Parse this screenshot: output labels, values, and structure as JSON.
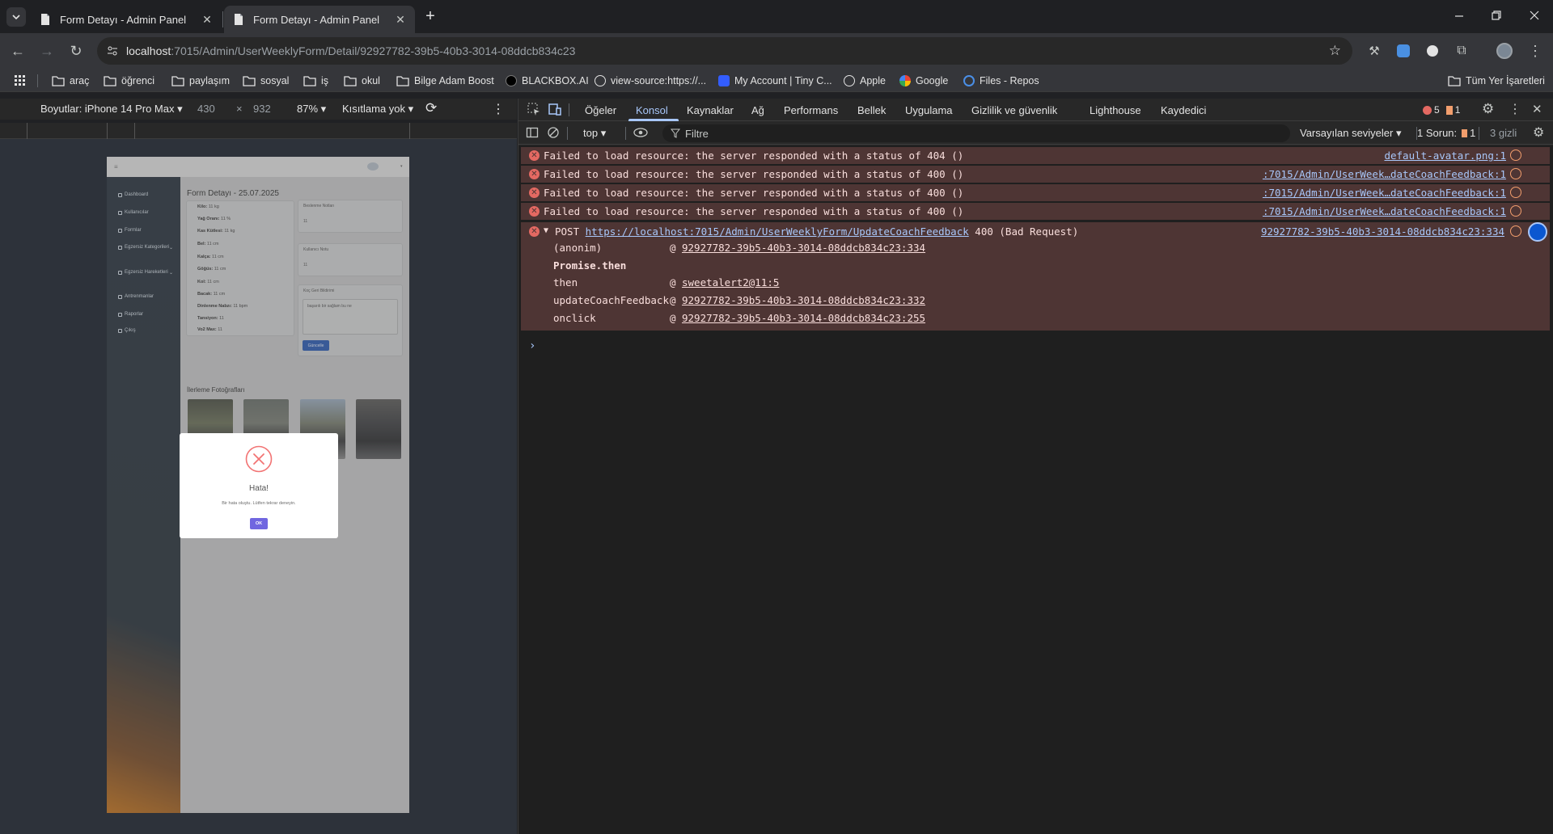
{
  "browser": {
    "tabs": [
      {
        "title": "Form Detayı - Admin Panel",
        "active": false
      },
      {
        "title": "Form Detayı - Admin Panel",
        "active": true
      }
    ],
    "url_host": "localhost",
    "url_rest": ":7015/Admin/UserWeeklyForm/Detail/92927782-39b5-40b3-3014-08ddcb834c23",
    "bookmarks": [
      "araç",
      "öğrenci",
      "paylaşım",
      "sosyal",
      "iş",
      "okul",
      "Bilge Adam Boost",
      "BLACKBOX.AI",
      "view-source:https://...",
      "My Account | Tiny C...",
      "Apple",
      "Google",
      "Files - Repos"
    ],
    "all_bookmarks": "Tüm Yer İşaretleri"
  },
  "device_toolbar": {
    "dimensions_label": "Boyutlar: iPhone 14 Pro Max",
    "width": "430",
    "times": "×",
    "height": "932",
    "zoom": "87%",
    "throttle": "Kısıtlama yok"
  },
  "phone": {
    "sidebar": [
      "Dashboard",
      "Kullanıcılar",
      "Formlar",
      "Egzersiz Kategorileri",
      "Egzersiz Hareketleri",
      "Antrenmanlar",
      "Raporlar",
      "Çıkış"
    ],
    "title": "Form Detayı - 25.07.2025",
    "measures": [
      {
        "k": "Kilo:",
        "v": "11 kg"
      },
      {
        "k": "Yağ Oranı:",
        "v": "11 %"
      },
      {
        "k": "Kas Kütlesi:",
        "v": "11 kg"
      },
      {
        "k": "Bel:",
        "v": "11 cm"
      },
      {
        "k": "Kalça:",
        "v": "11 cm"
      },
      {
        "k": "Göğüs:",
        "v": "11 cm"
      },
      {
        "k": "Kol:",
        "v": "11 cm"
      },
      {
        "k": "Bacak:",
        "v": "11 cm"
      },
      {
        "k": "Dinlenme Nabzı:",
        "v": "11 bpm"
      },
      {
        "k": "Tansiyon:",
        "v": "11"
      },
      {
        "k": "Vo2 Max:",
        "v": "11"
      }
    ],
    "notes": [
      {
        "label": "Beslenme Notları",
        "value": "11"
      },
      {
        "label": "Kullanıcı Notu",
        "value": "11"
      },
      {
        "label": "Koç Geri Bildirimi",
        "value": "başarılı bir sağlam bu ne"
      }
    ],
    "update_button": "Güncelle",
    "photos_title": "İlerleme Fotoğrafları",
    "dialog": {
      "title": "Hata!",
      "text": "Bir hata oluştu. Lütfen tekrar deneyin.",
      "ok": "OK"
    }
  },
  "devtools": {
    "tabs": [
      "Öğeler",
      "Konsol",
      "Kaynaklar",
      "Ağ",
      "Performans",
      "Bellek",
      "Uygulama",
      "Gizlilik ve güvenlik",
      "Lighthouse",
      "Kaydedici"
    ],
    "active_tab": "Konsol",
    "error_count": "5",
    "warn_count": "1",
    "context": "top",
    "filter_placeholder": "Filtre",
    "levels": "Varsayılan seviyeler",
    "issues_label": "1 Sorun:",
    "issues_count": "1",
    "hidden": "3 gizli",
    "messages": [
      {
        "text": "Failed to load resource: the server responded with a status of 404 ()",
        "source": "default-avatar.png:1"
      },
      {
        "text": "Failed to load resource: the server responded with a status of 400 ()",
        "source": ":7015/Admin/UserWeek…dateCoachFeedback:1"
      },
      {
        "text": "Failed to load resource: the server responded with a status of 400 ()",
        "source": ":7015/Admin/UserWeek…dateCoachFeedback:1"
      },
      {
        "text": "Failed to load resource: the server responded with a status of 400 ()",
        "source": ":7015/Admin/UserWeek…dateCoachFeedback:1"
      }
    ],
    "post": {
      "method": "POST",
      "url": "https://localhost:7015/Admin/UserWeeklyForm/UpdateCoachFeedback",
      "status": "400 (Bad Request)",
      "source": "92927782-39b5-40b3-3014-08ddcb834c23:334",
      "stack": [
        {
          "fn": "(anonim)",
          "at": "@",
          "loc": "92927782-39b5-40b3-3014-08ddcb834c23:334"
        },
        {
          "fn": "Promise.then",
          "at": "",
          "loc": ""
        },
        {
          "fn": "then",
          "at": "@",
          "loc": "sweetalert2@11:5"
        },
        {
          "fn": "updateCoachFeedback",
          "at": "@",
          "loc": "92927782-39b5-40b3-3014-08ddcb834c23:332"
        },
        {
          "fn": "onclick",
          "at": "@",
          "loc": "92927782-39b5-40b3-3014-08ddcb834c23:255"
        }
      ]
    },
    "prompt": "›"
  }
}
